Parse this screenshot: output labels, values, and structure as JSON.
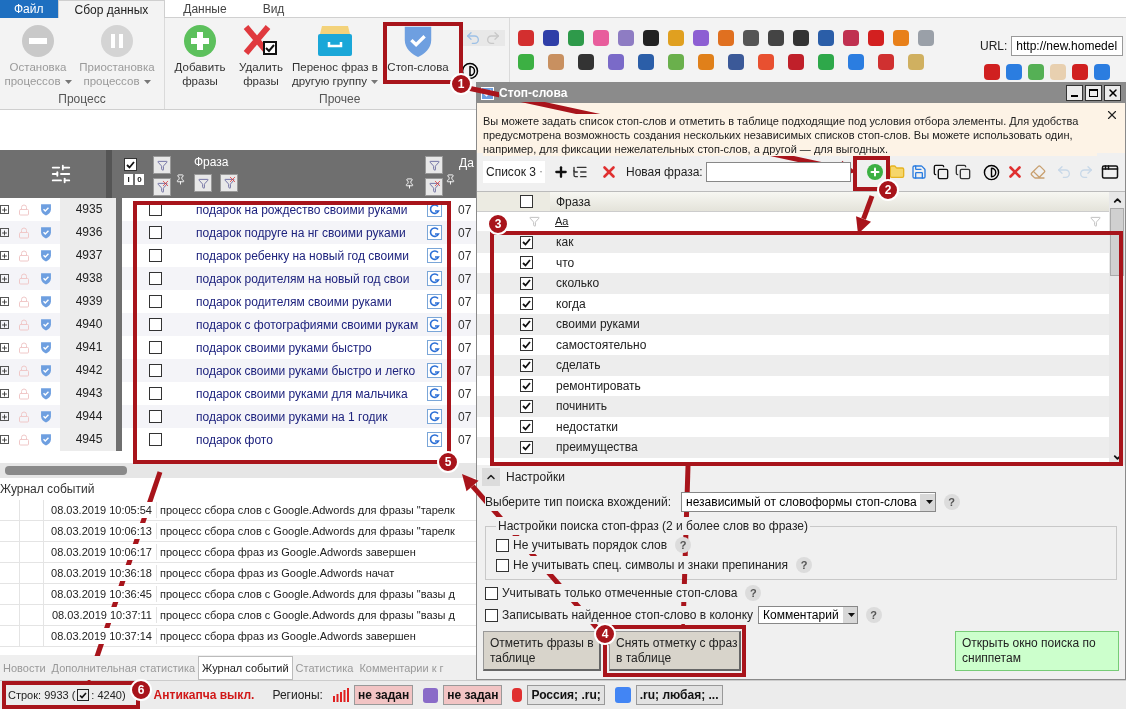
{
  "menu_tabs": [
    {
      "label": "Файл",
      "kind": "file",
      "selected": false
    },
    {
      "label": "Сбор данных",
      "kind": "tab",
      "selected": true
    },
    {
      "label": "Данные",
      "kind": "tab",
      "selected": false
    },
    {
      "label": "Вид",
      "kind": "tab",
      "selected": false
    }
  ],
  "ribbon": {
    "groups": [
      {
        "label": "Процесс",
        "buttons": [
          {
            "kind": "stop",
            "lines": [
              "Остановка",
              "процессов"
            ],
            "dropdown": true,
            "disabled": true
          },
          {
            "kind": "pause",
            "lines": [
              "Приостановка",
              "процессов"
            ],
            "dropdown": true,
            "disabled": true
          }
        ]
      },
      {
        "label": "Прочее",
        "buttons": [
          {
            "kind": "add",
            "lines": [
              "Добавить",
              "фразы"
            ],
            "dropdown": false,
            "disabled": false
          },
          {
            "kind": "delete",
            "lines": [
              "Удалить",
              "фразы"
            ],
            "dropdown": false,
            "disabled": false
          },
          {
            "kind": "transfer",
            "lines": [
              "Перенос фраз в",
              "другую группу"
            ],
            "dropdown": true,
            "disabled": false
          },
          {
            "kind": "stopwords",
            "lines": [
              "Стоп-слова"
            ],
            "dropdown": false,
            "disabled": false
          }
        ]
      }
    ],
    "url_label": "URL:",
    "url_value": "http://new.homedel"
  },
  "table": {
    "phrase_header": "Фраза",
    "date_header": "Да",
    "mark_buttons": [
      "I",
      "0"
    ],
    "rows": [
      {
        "number": "4935",
        "phrase": "подарок на рождество своими руками",
        "checked": false,
        "date": "07"
      },
      {
        "number": "4936",
        "phrase": "подарок подруге на нг своими руками",
        "checked": false,
        "date": "07"
      },
      {
        "number": "4937",
        "phrase": "подарок ребенку на новый год своими",
        "checked": false,
        "date": "07"
      },
      {
        "number": "4938",
        "phrase": "подарок родителям на новый год свои",
        "checked": false,
        "date": "07"
      },
      {
        "number": "4939",
        "phrase": "подарок родителям своими руками",
        "checked": false,
        "date": "07"
      },
      {
        "number": "4940",
        "phrase": "подарок с фотографиями своими рукам",
        "checked": false,
        "date": "07"
      },
      {
        "number": "4941",
        "phrase": "подарок своими руками быстро",
        "checked": false,
        "date": "07"
      },
      {
        "number": "4942",
        "phrase": "подарок своими руками быстро и легко",
        "checked": false,
        "date": "07"
      },
      {
        "number": "4943",
        "phrase": "подарок своими руками для мальчика",
        "checked": false,
        "date": "07"
      },
      {
        "number": "4944",
        "phrase": "подарок своими руками на 1 годик",
        "checked": false,
        "date": "07"
      },
      {
        "number": "4945",
        "phrase": "подарок фото",
        "checked": false,
        "date": "07"
      }
    ]
  },
  "log": {
    "title": "Журнал событий",
    "rows": [
      {
        "time": "08.03.2019 10:05:54",
        "message": "процесс сбора слов с Google.Adwords для фразы \"тарелк"
      },
      {
        "time": "08.03.2019 10:06:13",
        "message": "процесс сбора слов с Google.Adwords для фразы \"тарелк"
      },
      {
        "time": "08.03.2019 10:06:17",
        "message": "процесс сбора фраз из Google.Adwords завершен"
      },
      {
        "time": "08.03.2019 10:36:18",
        "message": "процесс сбора фраз из Google.Adwords начат"
      },
      {
        "time": "08.03.2019 10:36:45",
        "message": "процесс сбора слов с Google.Adwords для фразы \"вазы д"
      },
      {
        "time": "08.03.2019 10:37:11",
        "message": "процесс сбора слов с Google.Adwords для фразы \"вазы д"
      },
      {
        "time": "08.03.2019 10:37:14",
        "message": "процесс сбора фраз из Google.Adwords завершен"
      }
    ]
  },
  "bottom_tabs": [
    {
      "label": "Новости",
      "selected": false
    },
    {
      "label": "Дополнительная статистика",
      "selected": false
    },
    {
      "label": "Журнал событий",
      "selected": true
    },
    {
      "label": "Статистика",
      "selected": false
    },
    {
      "label": "Комментарии к г",
      "selected": false
    }
  ],
  "status": {
    "rows_prefix": "Строк: 9933 (",
    "rows_suffix": ": 4240)",
    "anticaptcha": "Антикапча выкл.",
    "regions_label": "Регионы:",
    "regions": [
      {
        "kind": "bars",
        "text": "не задан",
        "color": "#f2c4c4"
      },
      {
        "kind": "d",
        "text": "не задан",
        "color": "#f2c4c4"
      },
      {
        "kind": "ya",
        "text": "Россия; .ru;",
        "color": "#e2e2e2"
      },
      {
        "kind": "g",
        "text": ".ru; любая; ...",
        "color": "#e2e2e2"
      }
    ]
  },
  "dialog": {
    "title": "Стоп-слова",
    "info": "Вы можете задать список стоп-слов и отметить в таблице подходящие под условия отбора элементы. Для удобства предусмотрена возможность создания нескольких независимых списков стоп-слов. Вы можете использовать один, например, для фиксации нежелательных стоп-слов, а другой — для выгодных.",
    "list_select": "Список 3",
    "all_checked": false,
    "new_phrase_label": "Новая фраза:",
    "grid_header": "Фраза",
    "filter_text": "Aa",
    "items": [
      {
        "text": "как",
        "checked": true
      },
      {
        "text": "что",
        "checked": true
      },
      {
        "text": "сколько",
        "checked": true
      },
      {
        "text": "когда",
        "checked": true
      },
      {
        "text": "своими руками",
        "checked": true
      },
      {
        "text": "самостоятельно",
        "checked": true
      },
      {
        "text": "сделать",
        "checked": true
      },
      {
        "text": "ремонтировать",
        "checked": true
      },
      {
        "text": "починить",
        "checked": true
      },
      {
        "text": "недостатки",
        "checked": true
      },
      {
        "text": "преимущества",
        "checked": true
      }
    ],
    "settings": {
      "label": "Настройки",
      "expanded": true,
      "search_type": {
        "label": "Выберите тип поиска вхождений:",
        "value": "независимый от словоформы стоп-слова",
        "help": "?"
      },
      "group_title": "Настройки поиска стоп-фраз (2 и более слов во фразе)",
      "group_options": [
        {
          "label": "Не учитывать порядок слов",
          "checked": false,
          "help": "?"
        },
        {
          "label": "Не учитывать спец. символы и знаки препинания",
          "checked": false,
          "help": "?"
        }
      ],
      "options": [
        {
          "label": "Учитывать только отмеченные стоп-слова",
          "checked": false,
          "help": "?"
        },
        {
          "label": "Записывать найденное стоп-слово в колонку",
          "checked": false,
          "help": "?",
          "select": "Комментарий"
        }
      ]
    },
    "buttons": [
      {
        "lines": [
          "Отметить фразы в",
          "таблице"
        ],
        "kind": "plain"
      },
      {
        "lines": [
          "Снять отметку с фраз",
          "в таблице"
        ],
        "kind": "plain"
      },
      {
        "lines": [
          "Открыть окно поиска по",
          "сниппетам"
        ],
        "kind": "green"
      }
    ]
  },
  "annotations": [
    {
      "number": "1"
    },
    {
      "number": "2"
    },
    {
      "number": "3"
    },
    {
      "number": "4"
    },
    {
      "number": "5"
    },
    {
      "number": "6"
    }
  ]
}
